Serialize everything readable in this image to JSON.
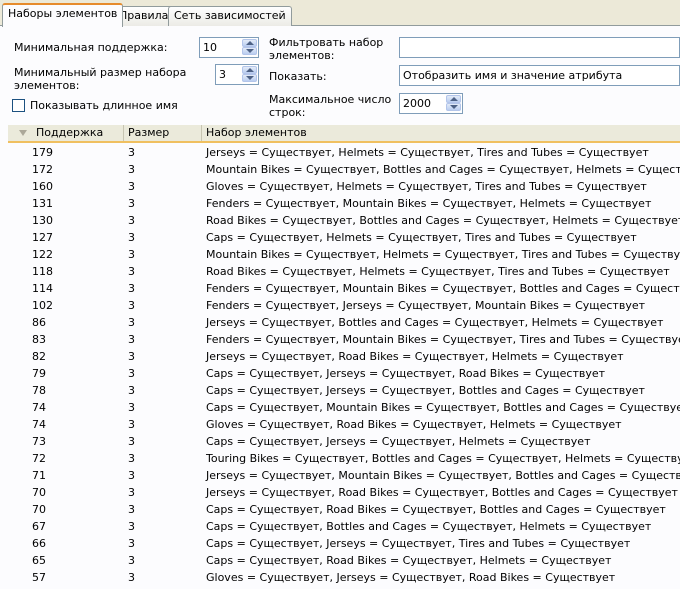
{
  "tabs": [
    {
      "label": "Наборы элементов"
    },
    {
      "label": "Правила"
    },
    {
      "label": "Сеть зависимостей"
    }
  ],
  "params": {
    "min_support_label": "Минимальная поддержка:",
    "min_support_value": "10",
    "min_itemset_size_label": "Минимальный размер набора элементов:",
    "min_itemset_size_value": "3",
    "show_long_name_label": "Показывать длинное имя",
    "filter_label": "Фильтровать набор элементов:",
    "filter_value": "",
    "show_label": "Показать:",
    "show_value": "Отобразить имя и значение атрибута",
    "max_rows_label": "Максимальное число строк:",
    "max_rows_value": "2000"
  },
  "grid": {
    "columns": [
      "Поддержка",
      "Размер",
      "Набор элементов"
    ],
    "rows": [
      [
        "179",
        "3",
        "Jerseys = Существует, Helmets = Существует, Tires and Tubes = Существует"
      ],
      [
        "172",
        "3",
        "Mountain Bikes = Существует, Bottles and Cages = Существует, Helmets = Существует"
      ],
      [
        "160",
        "3",
        "Gloves = Существует, Helmets = Существует, Tires and Tubes = Существует"
      ],
      [
        "131",
        "3",
        "Fenders = Существует, Mountain Bikes = Существует, Helmets = Существует"
      ],
      [
        "130",
        "3",
        "Road Bikes = Существует, Bottles and Cages = Существует, Helmets = Существует"
      ],
      [
        "127",
        "3",
        "Caps = Существует, Helmets = Существует, Tires and Tubes = Существует"
      ],
      [
        "122",
        "3",
        "Mountain Bikes = Существует, Helmets = Существует, Tires and Tubes = Существует"
      ],
      [
        "118",
        "3",
        "Road Bikes = Существует, Helmets = Существует, Tires and Tubes = Существует"
      ],
      [
        "114",
        "3",
        "Fenders = Существует, Mountain Bikes = Существует, Bottles and Cages = Существует"
      ],
      [
        "102",
        "3",
        "Fenders = Существует, Jerseys = Существует, Mountain Bikes = Существует"
      ],
      [
        "86",
        "3",
        "Jerseys = Существует, Bottles and Cages = Существует, Helmets = Существует"
      ],
      [
        "83",
        "3",
        "Fenders = Существует, Mountain Bikes = Существует, Tires and Tubes = Существует"
      ],
      [
        "82",
        "3",
        "Jerseys = Существует, Road Bikes = Существует, Helmets = Существует"
      ],
      [
        "79",
        "3",
        "Caps = Существует, Jerseys = Существует, Road Bikes = Существует"
      ],
      [
        "78",
        "3",
        "Caps = Существует, Jerseys = Существует, Bottles and Cages = Существует"
      ],
      [
        "74",
        "3",
        "Caps = Существует, Mountain Bikes = Существует, Bottles and Cages = Существует"
      ],
      [
        "74",
        "3",
        "Gloves = Существует, Road Bikes = Существует, Helmets = Существует"
      ],
      [
        "73",
        "3",
        "Caps = Существует, Jerseys = Существует, Helmets = Существует"
      ],
      [
        "72",
        "3",
        "Touring Bikes = Существует, Bottles and Cages = Существует, Helmets = Существует"
      ],
      [
        "71",
        "3",
        "Jerseys = Существует, Mountain Bikes = Существует, Bottles and Cages = Существует"
      ],
      [
        "70",
        "3",
        "Jerseys = Существует, Road Bikes = Существует, Bottles and Cages = Существует"
      ],
      [
        "70",
        "3",
        "Caps = Существует, Road Bikes = Существует, Bottles and Cages = Существует"
      ],
      [
        "67",
        "3",
        "Caps = Существует, Bottles and Cages = Существует, Helmets = Существует"
      ],
      [
        "66",
        "3",
        "Caps = Существует, Jerseys = Существует, Tires and Tubes = Существует"
      ],
      [
        "65",
        "3",
        "Caps = Существует, Road Bikes = Существует, Helmets = Существует"
      ],
      [
        "57",
        "3",
        "Gloves = Существует, Jerseys = Существует, Road Bikes = Существует"
      ]
    ]
  }
}
